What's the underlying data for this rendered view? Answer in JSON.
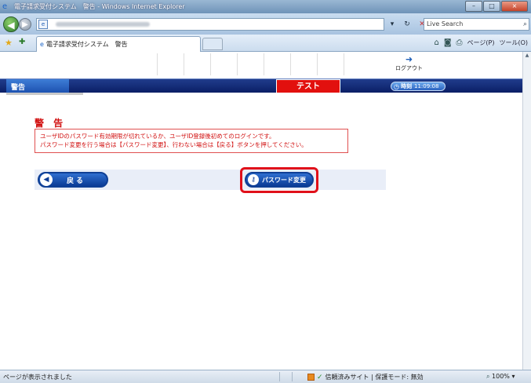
{
  "window": {
    "title": "電子請求受付システム　警告 - Windows Internet Explorer",
    "controls": [
      "–",
      "□",
      "×"
    ]
  },
  "addressbar": {
    "search_placeholder": "Live Search"
  },
  "tab": {
    "label": "電子請求受付システム　警告"
  },
  "commandbar": {
    "page_label": "ページ(P)",
    "tools_label": "ツール(O)"
  },
  "app": {
    "logout_label": "ログアウト",
    "section_label": "警告",
    "env_badge": "テスト",
    "clock_label": "時刻",
    "clock_value": "11:09:08"
  },
  "warning": {
    "title": "警 告",
    "line1": "ユーザIDのパスワード有効期限が切れているか、ユーザID登録後初めてのログインです。",
    "line2": "パスワード変更を行う場合は【パスワード変更】、行わない場合は【戻る】ボタンを押してください。"
  },
  "buttons": {
    "back_label": "戻る",
    "change_password_label": "パスワード変更"
  },
  "statusbar": {
    "status": "ページが表示されました",
    "trust": "信頼済みサイト | 保護モード: 無効",
    "zoom": "100%"
  },
  "colors": {
    "accent_red": "#d10f0f",
    "nav_blue": "#0b1f66",
    "env_red": "#e2100e"
  }
}
